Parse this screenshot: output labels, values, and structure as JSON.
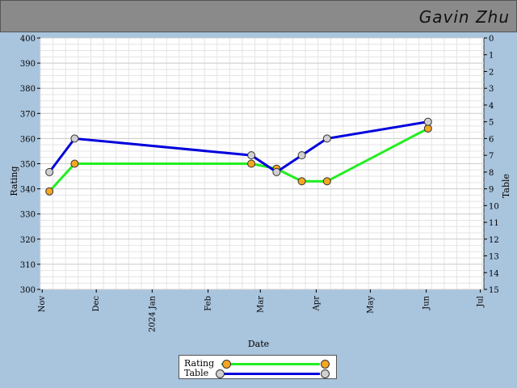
{
  "header": {
    "player_name": "Gavin Zhu"
  },
  "chart_data": {
    "type": "line",
    "title": "",
    "xlabel": "Date",
    "ylabel_left": "Rating",
    "ylabel_right": "Table",
    "x_ticks": [
      "Nov",
      "Dec",
      "2024 Jan",
      "Feb",
      "Mar",
      "Apr",
      "May",
      "Jun",
      "Jul"
    ],
    "y_left_range": [
      300,
      400
    ],
    "y_left_ticks": [
      300,
      310,
      320,
      330,
      340,
      350,
      360,
      370,
      380,
      390,
      400
    ],
    "y_right_range": [
      15,
      0
    ],
    "y_right_ticks": [
      0,
      1,
      2,
      3,
      4,
      5,
      6,
      7,
      8,
      9,
      10,
      11,
      12,
      13,
      14,
      15
    ],
    "grid": true,
    "legend_position": "bottom-center",
    "series": [
      {
        "name": "Rating",
        "axis": "left",
        "color": "#22ee22",
        "marker_color": "#f5a623",
        "points": [
          {
            "date": "2023-11-05",
            "value": 339
          },
          {
            "date": "2023-11-19",
            "value": 350
          },
          {
            "date": "2024-02-25",
            "value": 350
          },
          {
            "date": "2024-03-10",
            "value": 348
          },
          {
            "date": "2024-03-24",
            "value": 343
          },
          {
            "date": "2024-04-07",
            "value": 343
          },
          {
            "date": "2024-06-02",
            "value": 364
          }
        ]
      },
      {
        "name": "Table",
        "axis": "right",
        "color": "#0000dd",
        "marker_color": "#d0d0d0",
        "points": [
          {
            "date": "2023-11-05",
            "value": 8
          },
          {
            "date": "2023-11-19",
            "value": 6
          },
          {
            "date": "2024-02-25",
            "value": 7
          },
          {
            "date": "2024-03-10",
            "value": 8
          },
          {
            "date": "2024-03-24",
            "value": 7
          },
          {
            "date": "2024-04-07",
            "value": 6
          },
          {
            "date": "2024-06-02",
            "value": 5
          }
        ]
      }
    ]
  }
}
